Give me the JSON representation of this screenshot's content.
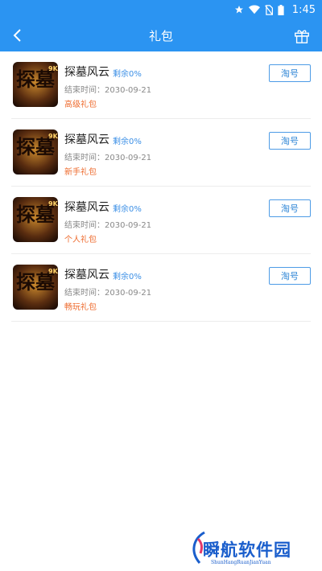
{
  "status_bar": {
    "time": "1:45"
  },
  "app_bar": {
    "title": "礼包"
  },
  "items": [
    {
      "game_name": "探墓风云",
      "remaining": "剩余0%",
      "end_time": "结束时间：2030-09-21",
      "gift_type": "高级礼包",
      "button_label": "淘号"
    },
    {
      "game_name": "探墓风云",
      "remaining": "剩余0%",
      "end_time": "结束时间：2030-09-21",
      "gift_type": "新手礼包",
      "button_label": "淘号"
    },
    {
      "game_name": "探墓风云",
      "remaining": "剩余0%",
      "end_time": "结束时间：2030-09-21",
      "gift_type": "个人礼包",
      "button_label": "淘号"
    },
    {
      "game_name": "探墓风云",
      "remaining": "剩余0%",
      "end_time": "结束时间：2030-09-21",
      "gift_type": "畅玩礼包",
      "button_label": "淘号"
    }
  ],
  "game_icon_text": {
    "main": "探墓",
    "badge": "9K"
  },
  "watermark": {
    "title": "瞬航软件园",
    "subtitle": "ShunHangRuanJianYuan"
  },
  "colors": {
    "primary": "#2b94f2",
    "accent_text": "#3b8fe6",
    "gift_type": "#ee6a2c"
  }
}
